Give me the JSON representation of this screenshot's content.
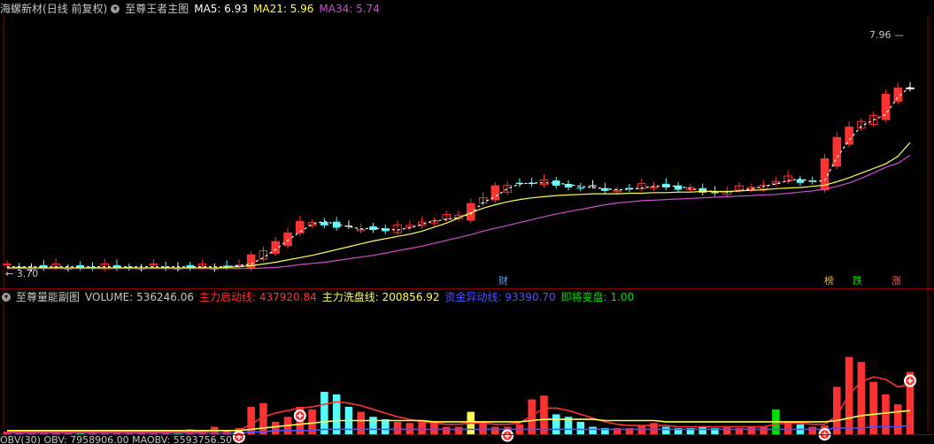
{
  "main_panel": {
    "stock_name": "海螺新材",
    "period": "(日线 前复权)",
    "indicator": "至尊王者主图",
    "ma5": "MA5: 6.93",
    "ma21": "MA21: 5.96",
    "ma34": "MA34: 5.74",
    "high_label": "7.96",
    "low_label": "3.70",
    "markers": {
      "cai": "财",
      "bang": "榜",
      "die": "跌",
      "zhang": "涨"
    }
  },
  "sub_panel": {
    "indicator": "至尊量能副图",
    "volume": "VOLUME: 536246.06",
    "zhuli_qidong": "主力启动线: 437920.84",
    "zhuli_xipan": "主力洗盘线: 200856.92",
    "zijin_yidong": "资金异动线: 93390.70",
    "jijiang_bianpan": "即将变盘: 1.00"
  },
  "bottom_panel": {
    "label": "OBV(30)  OBV: 7958906.00  MAOBV: 5593756.50"
  },
  "colors": {
    "up": "#ff3232",
    "down": "#54fcfc",
    "flat": "#ffffff",
    "ma21": "#ffff54",
    "ma34": "#d24cd2",
    "ma5": "#ffffff",
    "zhuli_qidong": "#ff3232",
    "zhuli_xipan": "#ffff54",
    "zijin_yidong": "#5050ff",
    "jijiang_bianpan": "#00e000",
    "grid": "#8a0000"
  },
  "chart_data": [
    {
      "type": "candlestick",
      "title": "至尊王者主图",
      "ylim": [
        3.55,
        8.1
      ],
      "series": [
        {
          "name": "MA5",
          "values": [
            3.8,
            3.8,
            3.8,
            3.8,
            3.8,
            3.8,
            3.8,
            3.8,
            3.8,
            3.8,
            3.8,
            3.8,
            3.8,
            3.8,
            3.8,
            3.8,
            3.8,
            3.8,
            3.8,
            3.82,
            3.85,
            3.96,
            4.1,
            4.26,
            4.41,
            4.54,
            4.59,
            4.54,
            4.5,
            4.46,
            4.47,
            4.46,
            4.44,
            4.48,
            4.54,
            4.6,
            4.62,
            4.66,
            4.72,
            4.92,
            5.02,
            5.16,
            5.24,
            5.26,
            5.26,
            5.26,
            5.23,
            5.2,
            5.18,
            5.16,
            5.14,
            5.15,
            5.17,
            5.2,
            5.21,
            5.2,
            5.16,
            5.13,
            5.11,
            5.1,
            5.12,
            5.16,
            5.2,
            5.24,
            5.3,
            5.33,
            5.28,
            5.3,
            5.7,
            6.0,
            6.25,
            6.35,
            6.45,
            6.75,
            6.93
          ]
        },
        {
          "name": "MA21",
          "values": [
            3.78,
            3.78,
            3.78,
            3.78,
            3.78,
            3.78,
            3.78,
            3.78,
            3.78,
            3.78,
            3.78,
            3.78,
            3.78,
            3.78,
            3.78,
            3.78,
            3.78,
            3.78,
            3.79,
            3.8,
            3.82,
            3.85,
            3.88,
            3.92,
            3.96,
            4.0,
            4.05,
            4.1,
            4.15,
            4.2,
            4.25,
            4.29,
            4.33,
            4.37,
            4.42,
            4.49,
            4.56,
            4.65,
            4.74,
            4.82,
            4.88,
            4.93,
            4.97,
            5.0,
            5.02,
            5.04,
            5.05,
            5.06,
            5.07,
            5.07,
            5.07,
            5.08,
            5.08,
            5.09,
            5.09,
            5.1,
            5.1,
            5.11,
            5.11,
            5.11,
            5.12,
            5.13,
            5.14,
            5.16,
            5.17,
            5.18,
            5.2,
            5.22,
            5.28,
            5.35,
            5.43,
            5.51,
            5.59,
            5.72,
            5.96
          ]
        },
        {
          "name": "MA34",
          "values": [
            3.77,
            3.77,
            3.77,
            3.77,
            3.77,
            3.77,
            3.77,
            3.77,
            3.77,
            3.77,
            3.77,
            3.77,
            3.77,
            3.77,
            3.77,
            3.77,
            3.77,
            3.77,
            3.77,
            3.77,
            3.77,
            3.78,
            3.79,
            3.81,
            3.84,
            3.86,
            3.88,
            3.91,
            3.94,
            3.97,
            4.0,
            4.04,
            4.08,
            4.12,
            4.16,
            4.21,
            4.26,
            4.31,
            4.36,
            4.42,
            4.47,
            4.52,
            4.57,
            4.62,
            4.67,
            4.72,
            4.76,
            4.8,
            4.84,
            4.88,
            4.91,
            4.93,
            4.95,
            4.96,
            4.97,
            4.98,
            4.99,
            5.0,
            5.01,
            5.02,
            5.03,
            5.04,
            5.05,
            5.06,
            5.08,
            5.1,
            5.12,
            5.15,
            5.2,
            5.26,
            5.34,
            5.43,
            5.53,
            5.6,
            5.74
          ]
        }
      ]
    },
    {
      "type": "bar",
      "title": "至尊量能副图",
      "series": [
        {
          "name": "VOLUME",
          "values": [
            0.02,
            0.01,
            0.02,
            0.03,
            0.03,
            0.02,
            0.03,
            0.02,
            0.02,
            0.03,
            0.02,
            0.02,
            0.02,
            0.02,
            0.03,
            0.04,
            0.02,
            0.06,
            0.03,
            0.05,
            0.22,
            0.25,
            0.1,
            0.14,
            0.22,
            0.2,
            0.34,
            0.32,
            0.22,
            0.18,
            0.14,
            0.12,
            0.1,
            0.09,
            0.11,
            0.1,
            0.06,
            0.06,
            0.18,
            0.1,
            0.06,
            0.06,
            0.08,
            0.28,
            0.31,
            0.16,
            0.14,
            0.1,
            0.06,
            0.05,
            0.05,
            0.05,
            0.07,
            0.09,
            0.06,
            0.05,
            0.05,
            0.06,
            0.05,
            0.06,
            0.05,
            0.06,
            0.06,
            0.2,
            0.1,
            0.08,
            0.06,
            0.07,
            0.38,
            0.62,
            0.58,
            0.42,
            0.32,
            0.24,
            0.5
          ]
        },
        {
          "name": "主力启动线",
          "values": [
            0.02,
            0.02,
            0.02,
            0.02,
            0.02,
            0.02,
            0.02,
            0.02,
            0.02,
            0.02,
            0.02,
            0.02,
            0.02,
            0.02,
            0.02,
            0.02,
            0.02,
            0.03,
            0.03,
            0.03,
            0.08,
            0.14,
            0.17,
            0.19,
            0.21,
            0.22,
            0.24,
            0.26,
            0.25,
            0.23,
            0.2,
            0.17,
            0.14,
            0.12,
            0.1,
            0.09,
            0.08,
            0.08,
            0.09,
            0.09,
            0.08,
            0.08,
            0.09,
            0.15,
            0.21,
            0.21,
            0.19,
            0.16,
            0.13,
            0.1,
            0.08,
            0.07,
            0.07,
            0.07,
            0.07,
            0.06,
            0.06,
            0.06,
            0.06,
            0.06,
            0.06,
            0.06,
            0.06,
            0.08,
            0.09,
            0.09,
            0.08,
            0.08,
            0.15,
            0.32,
            0.42,
            0.46,
            0.44,
            0.38,
            0.4
          ]
        },
        {
          "name": "主力洗盘线",
          "values": [
            0.03,
            0.03,
            0.03,
            0.03,
            0.03,
            0.03,
            0.03,
            0.03,
            0.03,
            0.03,
            0.03,
            0.03,
            0.03,
            0.03,
            0.03,
            0.03,
            0.03,
            0.03,
            0.03,
            0.03,
            0.04,
            0.05,
            0.06,
            0.07,
            0.08,
            0.09,
            0.1,
            0.11,
            0.11,
            0.11,
            0.11,
            0.11,
            0.11,
            0.11,
            0.11,
            0.1,
            0.1,
            0.1,
            0.1,
            0.1,
            0.1,
            0.1,
            0.1,
            0.11,
            0.12,
            0.12,
            0.12,
            0.12,
            0.12,
            0.11,
            0.11,
            0.11,
            0.11,
            0.11,
            0.1,
            0.1,
            0.1,
            0.1,
            0.1,
            0.1,
            0.1,
            0.1,
            0.1,
            0.1,
            0.1,
            0.1,
            0.1,
            0.1,
            0.11,
            0.13,
            0.15,
            0.16,
            0.17,
            0.18,
            0.19
          ]
        },
        {
          "name": "资金异动线",
          "values": [
            0.01,
            0.01,
            0.01,
            0.01,
            0.01,
            0.01,
            0.01,
            0.01,
            0.01,
            0.01,
            0.01,
            0.01,
            0.01,
            0.01,
            0.01,
            0.01,
            0.01,
            0.01,
            0.01,
            0.01,
            0.02,
            0.02,
            0.03,
            0.03,
            0.03,
            0.03,
            0.04,
            0.04,
            0.04,
            0.04,
            0.04,
            0.04,
            0.04,
            0.04,
            0.04,
            0.04,
            0.04,
            0.04,
            0.04,
            0.04,
            0.04,
            0.04,
            0.04,
            0.04,
            0.04,
            0.04,
            0.04,
            0.04,
            0.04,
            0.04,
            0.04,
            0.04,
            0.04,
            0.04,
            0.04,
            0.04,
            0.04,
            0.04,
            0.04,
            0.04,
            0.04,
            0.04,
            0.04,
            0.04,
            0.04,
            0.04,
            0.04,
            0.04,
            0.05,
            0.05,
            0.05,
            0.06,
            0.06,
            0.06,
            0.07
          ]
        }
      ]
    }
  ]
}
